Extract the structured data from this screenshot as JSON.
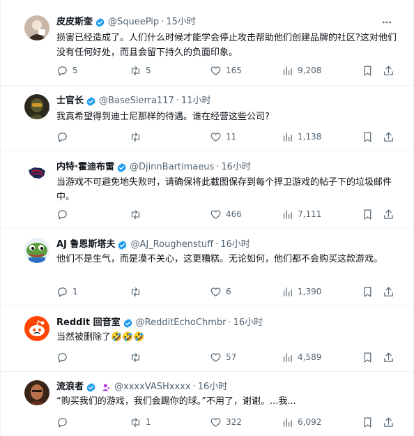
{
  "colors": {
    "verified": "#1d9bf0",
    "text": "#0f1419",
    "muted": "#536471",
    "divider": "#eff3f4"
  },
  "tweets": [
    {
      "name": "皮皮斯奎",
      "handle": "@SqueePip",
      "dot": "·",
      "time": "15小时",
      "text": "损害已经造成了。人们什么时候才能学会停止攻击帮助他们创建品牌的社区?这对他们没有任何好处，而且会留下持久的负面印象。",
      "replies": "5",
      "retweets": "5",
      "likes": "165",
      "views": "9,208"
    },
    {
      "name": "士官长",
      "handle": "@BaseSierra117",
      "dot": "·",
      "time": "11小时",
      "text": "我真希望得到迪士尼那样的待遇。谁在经营这些公司?",
      "replies": "",
      "retweets": "",
      "likes": "11",
      "views": "1,138"
    },
    {
      "name": "内特·霍迪布雷",
      "handle": "@DjinnBartimaeus",
      "dot": "·",
      "time": "16小时",
      "text": "当游戏不可避免地失败时，请确保将此截图保存到每个捍卫游戏的帖子下的垃圾邮件中。",
      "replies": "",
      "retweets": "",
      "likes": "466",
      "views": "7,111"
    },
    {
      "name": "AJ 鲁恩斯塔夫",
      "handle": "@AJ_Roughenstuff",
      "dot": "·",
      "time": "16小时",
      "text": "他们不是生气，而是漠不关心，这更糟糕。无论如何，他们都不会购买这款游戏。",
      "replies": "1",
      "retweets": "",
      "likes": "6",
      "views": "1,390"
    },
    {
      "name": "Reddit 回音室",
      "handle": "@RedditEchoChmbr",
      "dot": "·",
      "time": "16小时",
      "text": "当然被删除了",
      "emoji": "🤣🤣🤣",
      "replies": "",
      "retweets": "",
      "likes": "57",
      "views": "4,589"
    },
    {
      "name": "流浪者",
      "handle": "@xxxxVASHxxxx",
      "dot": "·",
      "time": "16小时",
      "text": "“购买我们的游戏，我们会踢你的球。”不用了，谢谢。...我...",
      "replies": "",
      "retweets": "1",
      "likes": "322",
      "views": "6,092"
    }
  ]
}
